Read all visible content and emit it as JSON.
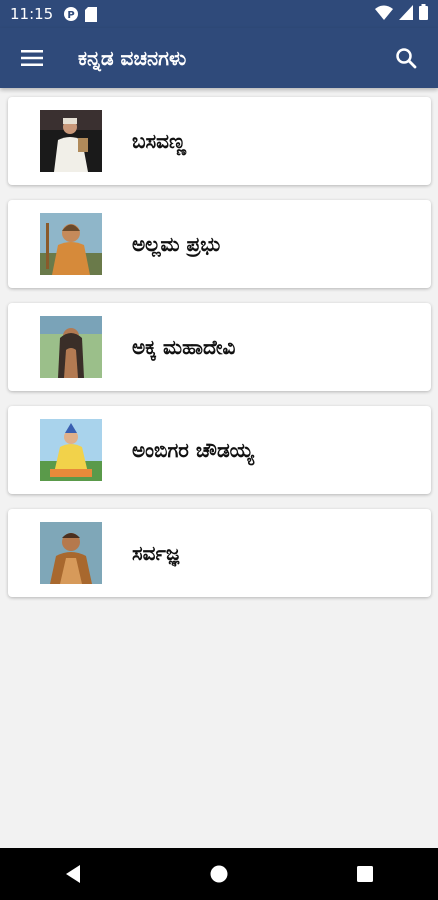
{
  "status_bar": {
    "time": "11:15",
    "icons": [
      "p-notification-icon",
      "sd-card-icon",
      "wifi-icon",
      "signal-icon",
      "battery-icon"
    ]
  },
  "app_bar": {
    "title": "ಕನ್ನಡ ವಚನಗಳು",
    "menu_icon": "hamburger-menu-icon",
    "search_icon": "search-icon",
    "color": "#2f4a7a"
  },
  "items": [
    {
      "label": "ಬಸವಣ್ಣ",
      "image": "basavanna-portrait"
    },
    {
      "label": "ಅಲ್ಲಮ ಪ್ರಭು",
      "image": "allama-prabhu-portrait"
    },
    {
      "label": "ಅಕ್ಕ ಮಹಾದೇವಿ",
      "image": "akka-mahadevi-portrait"
    },
    {
      "label": "ಅಂಬಿಗರ ಚೌಡಯ್ಯ",
      "image": "ambigara-chowdaiah-portrait"
    },
    {
      "label": "ಸರ್ವಜ್ಞ",
      "image": "sarvajna-portrait"
    }
  ],
  "nav_bar": {
    "icons": [
      "back-icon",
      "home-icon",
      "recents-icon"
    ]
  }
}
